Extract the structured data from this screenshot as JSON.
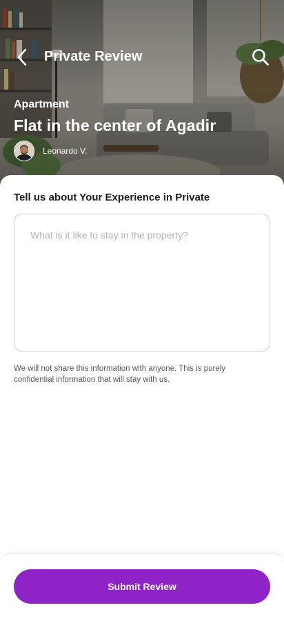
{
  "header": {
    "title": "Private Review",
    "back_icon": "chevron-left-icon",
    "search_icon": "search-icon"
  },
  "property": {
    "type": "Apartment",
    "title": "Flat in the center of Agadir",
    "host_name": "Leonardo V."
  },
  "review": {
    "heading": "Tell us about Your Experience in Private",
    "placeholder": "What is it like to stay in the property?",
    "value": "",
    "privacy_note": "We will not share this information with anyone. This is purely confidential information that will stay with us."
  },
  "footer": {
    "submit_label": "Submit Review"
  },
  "colors": {
    "accent": "#8e24c8",
    "text_primary": "#1c1c1f",
    "text_secondary": "#55555c",
    "placeholder": "#b4b4ba",
    "border": "#cfcfd4"
  }
}
